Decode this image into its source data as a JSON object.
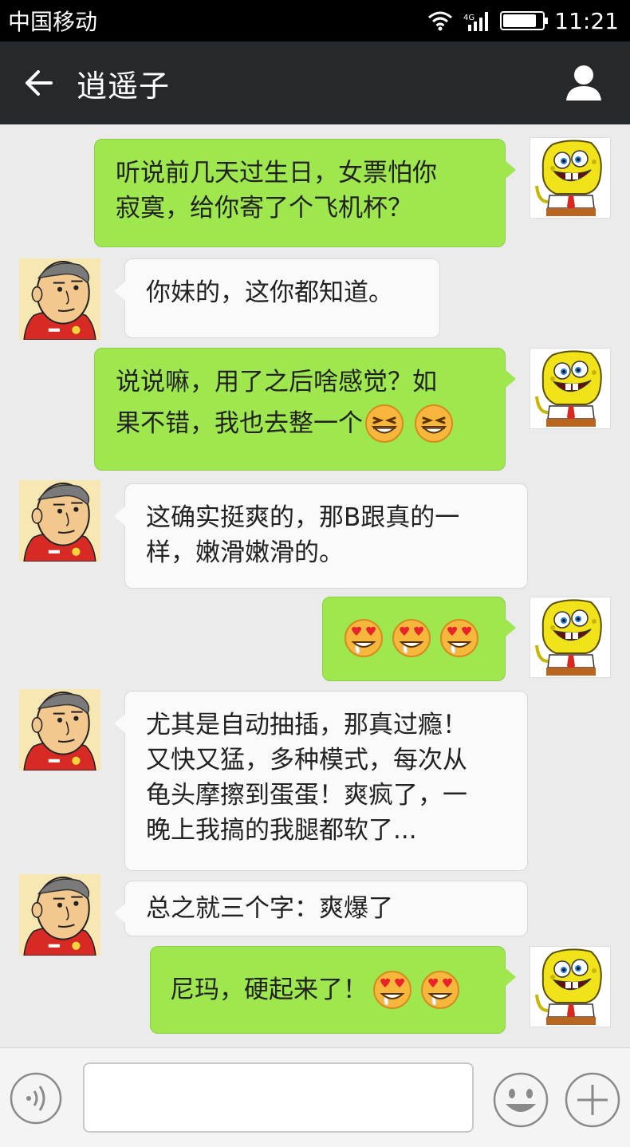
{
  "status_bar": {
    "carrier": "中国移动",
    "time": "11:21",
    "battery_level": 0.85
  },
  "header": {
    "back_icon": "arrow-left-icon",
    "title": "逍遥子",
    "profile_icon": "person-icon"
  },
  "messages": [
    {
      "side": "out",
      "text": "听说前几天过生日，女票怕你寂寞，给你寄了个飞机杯？",
      "line1": "听说前几天过生日，女票怕你",
      "line2": "寂寞，给你寄了个飞机杯？"
    },
    {
      "side": "in",
      "text": "你妹的，这你都知道。"
    },
    {
      "side": "out",
      "line1": "说说嘛，用了之后啥感觉？如",
      "line2": "果不错，我也去整一个",
      "emojis": [
        "grin-emoji",
        "grin-emoji"
      ]
    },
    {
      "side": "in",
      "line1": "这确实挺爽的，那B跟真的一",
      "line2": "样，嫩滑嫩滑的。"
    },
    {
      "side": "out",
      "emojis": [
        "heart-eyes-drool-emoji",
        "heart-eyes-drool-emoji",
        "heart-eyes-drool-emoji"
      ]
    },
    {
      "side": "in",
      "line1": "尤其是自动抽插，那真过瘾！",
      "line2": "又快又猛，多种模式，每次从",
      "line3": "龟头摩擦到蛋蛋！爽疯了，一",
      "line4": "晚上我搞的我腿都软了..."
    },
    {
      "side": "in",
      "text": "总之就三个字：爽爆了"
    },
    {
      "side": "out",
      "text": "尼玛，硬起来了！",
      "emojis": [
        "heart-eyes-drool-emoji",
        "heart-eyes-drool-emoji"
      ]
    }
  ],
  "input_bar": {
    "voice_icon": "voice-icon",
    "input_value": "",
    "emoji_icon": "smiley-icon",
    "plus_icon": "plus-icon"
  },
  "colors": {
    "outgoing_bubble": "#9ee74f",
    "incoming_bubble": "#fafafa",
    "nav_bar": "#26292b",
    "background": "#ebebeb"
  }
}
